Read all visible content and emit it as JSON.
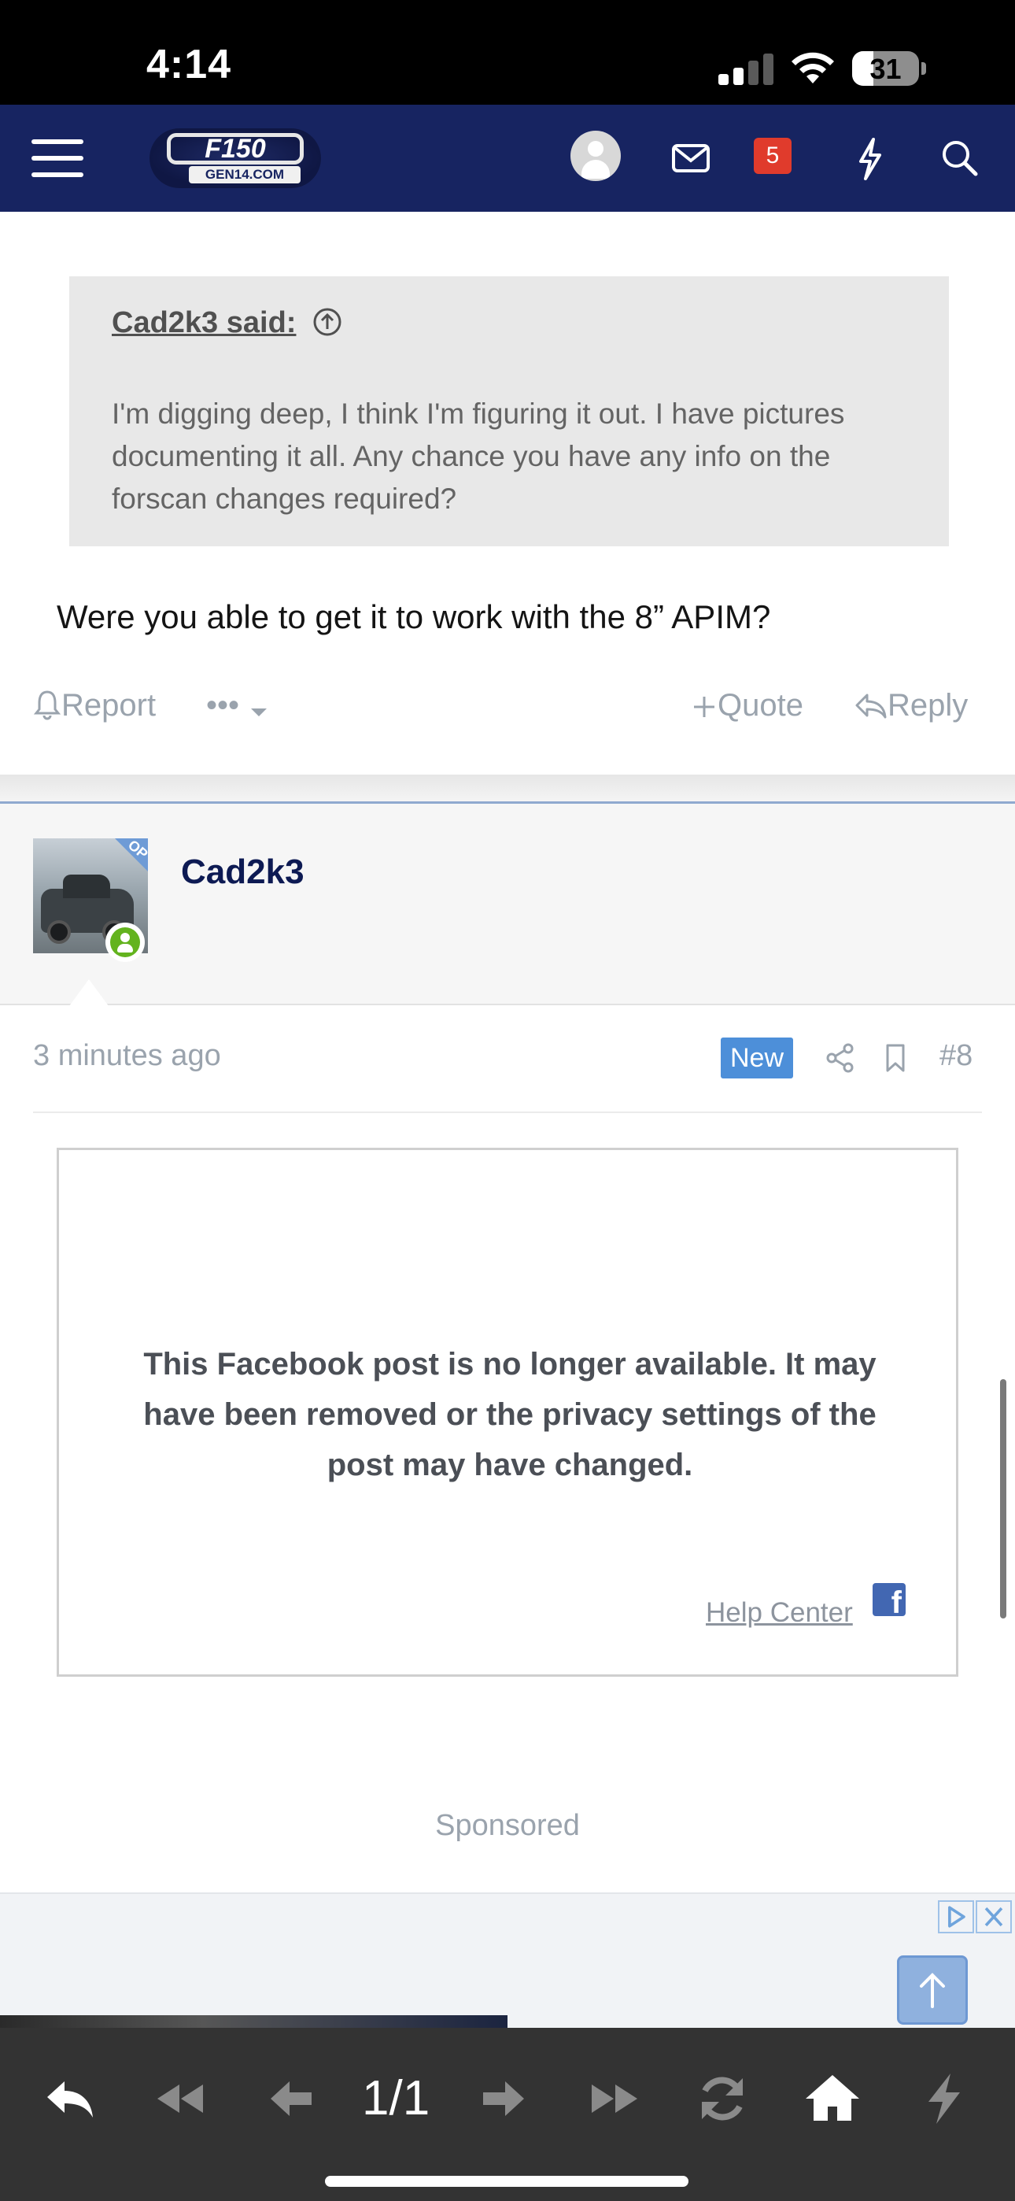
{
  "status_bar": {
    "time": "4:14",
    "battery": "31"
  },
  "nav": {
    "logo_main": "F150",
    "logo_sub": "GEN14.COM",
    "notification_count": "5"
  },
  "quote": {
    "author": "Cad2k3 said:",
    "text": "I'm digging deep, I think I'm figuring it out. I have pictures documenting it all. Any chance you have any info on the forscan changes required?"
  },
  "post": {
    "text": "Were you able to get it to work with the 8” APIM?",
    "actions": {
      "report": "Report",
      "more": "•••",
      "quote": "Quote",
      "reply": "Reply"
    }
  },
  "next_post": {
    "username": "Cad2k3",
    "avatar_tag": "OP",
    "time": "3 minutes ago",
    "new_badge": "New",
    "number": "#8"
  },
  "facebook_embed": {
    "message": "This Facebook post is no longer available. It may have been removed or the privacy settings of the post may have changed.",
    "help_link": "Help Center",
    "logo_letter": "f"
  },
  "ads": {
    "sponsored_label": "Sponsored"
  },
  "toolbar": {
    "page_indicator": "1/1"
  },
  "colors": {
    "nav_bg": "#172461",
    "accent_blue": "#4d8fd9",
    "badge_red": "#e03b2c",
    "online_green": "#63b31e",
    "toolbar_bg": "#333333"
  }
}
